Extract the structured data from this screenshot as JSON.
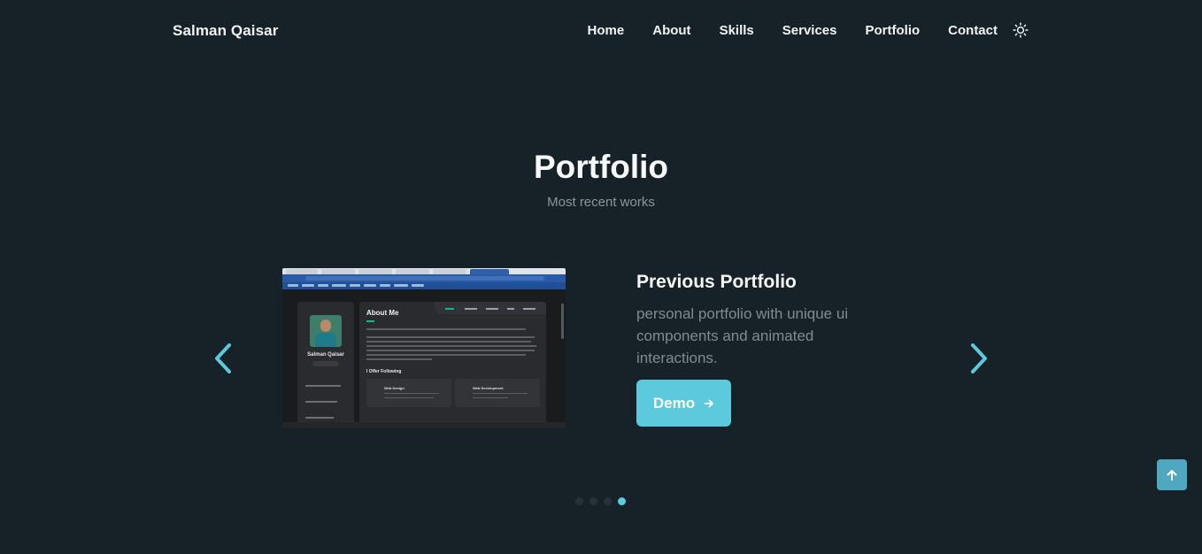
{
  "header": {
    "brand": "Salman Qaisar",
    "nav": [
      {
        "label": "Home"
      },
      {
        "label": "About"
      },
      {
        "label": "Skills"
      },
      {
        "label": "Services"
      },
      {
        "label": "Portfolio"
      },
      {
        "label": "Contact"
      }
    ],
    "theme_icon": "sun-icon"
  },
  "section": {
    "title": "Portfolio",
    "subtitle": "Most recent works"
  },
  "slide": {
    "title": "Previous Portfolio",
    "description": "personal portfolio with unique ui components and animated interactions.",
    "button_label": "Demo",
    "preview": {
      "name": "Salman Qaisar",
      "heading": "About Me",
      "section": "I Offer Following",
      "services": [
        "Web Design",
        "Web Development"
      ]
    }
  },
  "carousel": {
    "slide_count": 4,
    "active_index": 3,
    "prev_icon": "chevron-left-icon",
    "next_icon": "chevron-right-icon"
  },
  "scroll_top_icon": "arrow-up-icon",
  "colors": {
    "background": "#172128",
    "accent": "#5cc9dc",
    "muted_text": "#7f8b92"
  }
}
